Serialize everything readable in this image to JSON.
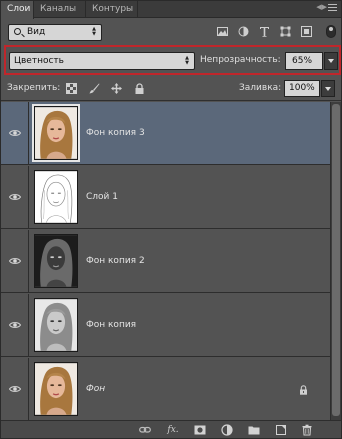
{
  "tabs": [
    {
      "label": "Слои",
      "active": true
    },
    {
      "label": "Каналы",
      "active": false
    },
    {
      "label": "Контуры",
      "active": false
    }
  ],
  "filter": {
    "kind_value": "Вид",
    "icons": [
      "image-filter-icon",
      "adjustment-filter-icon",
      "type-filter-icon",
      "shape-filter-icon",
      "smart-object-filter-icon"
    ]
  },
  "blend": {
    "mode_value": "Цветность",
    "opacity_label": "Непрозрачность:",
    "opacity_value": "65%"
  },
  "lock": {
    "label": "Закрепить:",
    "icons": [
      "lock-transparent-icon",
      "lock-brush-icon",
      "lock-position-icon",
      "lock-all-icon"
    ],
    "fill_label": "Заливка:",
    "fill_value": "100%"
  },
  "layers": [
    {
      "name": "Фон копия 3",
      "selected": true,
      "visible": true,
      "thumb": "color-portrait"
    },
    {
      "name": "Слой 1",
      "selected": false,
      "visible": true,
      "thumb": "sketch"
    },
    {
      "name": "Фон копия 2",
      "selected": false,
      "visible": true,
      "thumb": "dark-inverted"
    },
    {
      "name": "Фон копия",
      "selected": false,
      "visible": true,
      "thumb": "grayscale-portrait"
    },
    {
      "name": "Фон",
      "selected": false,
      "visible": true,
      "thumb": "color-portrait",
      "italic": true,
      "locked": true
    }
  ],
  "bottom_icons": [
    "link-layers-icon",
    "fx-icon",
    "add-mask-icon",
    "adjustment-layer-icon",
    "new-group-icon",
    "new-layer-icon",
    "delete-layer-icon"
  ],
  "colors": {
    "panel_bg": "#535353",
    "selected_row": "#5b687a",
    "highlight_box": "#c0262b"
  }
}
